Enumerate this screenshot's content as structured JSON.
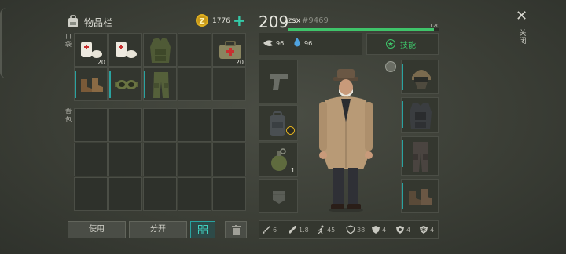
{
  "inventory": {
    "title": "物品栏",
    "coins": "1776",
    "plus": "+",
    "pockets_label": "口袋",
    "backpack_label": "背包",
    "pocket_items": [
      {
        "name": "bandage-icon",
        "count": "20"
      },
      {
        "name": "bandage-icon",
        "count": "11"
      },
      {
        "name": "tactical-vest-icon",
        "count": ""
      },
      {
        "name": "empty",
        "count": ""
      },
      {
        "name": "first-aid-kit-icon",
        "count": "20"
      },
      {
        "name": "boots-icon",
        "count": ""
      },
      {
        "name": "goggles-icon",
        "count": ""
      },
      {
        "name": "pants-icon",
        "count": ""
      },
      {
        "name": "empty",
        "count": ""
      },
      {
        "name": "empty",
        "count": ""
      }
    ]
  },
  "buttons": {
    "use": "使用",
    "split": "分开"
  },
  "player": {
    "level": "209",
    "name": "zsx",
    "id": "#9469",
    "health": "120",
    "health_fill": 0.97,
    "food": "96",
    "water": "96",
    "skills": "技能",
    "close": "关闭",
    "close_symbol": "✕"
  },
  "equipment": {
    "grenade_count": "1"
  },
  "stats": [
    {
      "icon": "sword-icon",
      "value": "6"
    },
    {
      "icon": "gun-icon",
      "value": "1.8"
    },
    {
      "icon": "run-icon",
      "value": "45"
    },
    {
      "icon": "shield-icon",
      "value": "38"
    },
    {
      "icon": "armor-icon",
      "value": "4"
    },
    {
      "icon": "bio-icon",
      "value": "4"
    },
    {
      "icon": "cold-icon",
      "value": "4"
    }
  ],
  "colors": {
    "accent": "#2aa3a0",
    "health": "#3fc46a",
    "water": "#4fa3e0",
    "coin": "#e0b020"
  }
}
